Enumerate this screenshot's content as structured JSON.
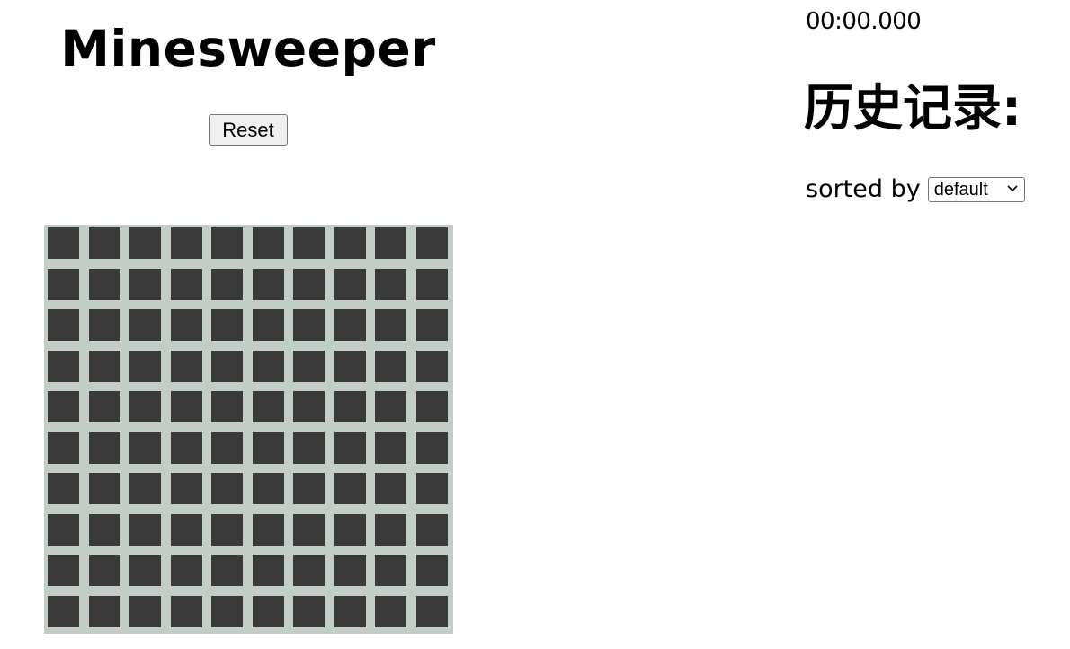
{
  "header": {
    "title": "Minesweeper",
    "reset_label": "Reset"
  },
  "timer": {
    "value": "00:00.000"
  },
  "history": {
    "title": "历史记录:",
    "sort_label": "sorted by",
    "sort_selected": "default",
    "chevron_icon": "chevron-down-icon"
  },
  "board": {
    "rows": 10,
    "cols": 10,
    "cell_state": "unrevealed",
    "colors": {
      "board_bg": "#c2cdc6",
      "cell_covered": "#3a3a3a"
    }
  }
}
